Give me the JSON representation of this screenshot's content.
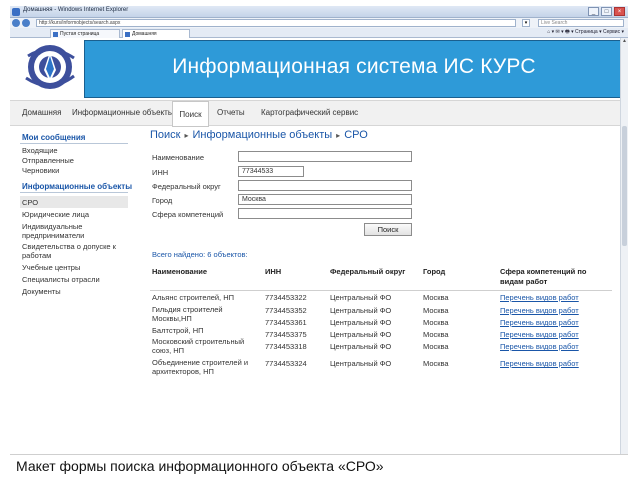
{
  "browser": {
    "window_title": "Домашняя - Windows Internet Explorer",
    "url": "http://kurs/informobjects/search.aspx",
    "search_placeholder": "Live Search",
    "tabs": [
      {
        "label": "Пустая страница"
      },
      {
        "label": "Домашняя"
      }
    ],
    "tools": "⌂ ▾  ✉ ▾  🖶 ▾  Страница ▾  Сервис ▾"
  },
  "banner": {
    "title": "Информационная  система ИС  КУРС"
  },
  "menu": {
    "items": [
      {
        "label": "Домашняя"
      },
      {
        "label": "Информационные объекты"
      },
      {
        "label": "Поиск"
      },
      {
        "label": "Отчеты"
      },
      {
        "label": "Картографический сервис"
      }
    ]
  },
  "sidebar": {
    "messages_title": "Мои сообщения",
    "messages_items": [
      {
        "label": "Входящие"
      },
      {
        "label": "Отправленные"
      },
      {
        "label": "Черновики"
      }
    ],
    "objects_title": "Информационные объекты",
    "objects_items": [
      {
        "label": "СРО"
      },
      {
        "label": "Юридические лица"
      },
      {
        "label": "Индивидуальные предприниматели"
      },
      {
        "label": "Свидетельства о допуске к работам"
      },
      {
        "label": "Учебные центры"
      },
      {
        "label": "Специалисты отрасли"
      },
      {
        "label": "Документы"
      }
    ]
  },
  "breadcrumb": [
    "Поиск",
    "Информационные объекты",
    "СРО"
  ],
  "form": {
    "fields": [
      {
        "label": "Наименование",
        "value": ""
      },
      {
        "label": "ИНН",
        "value": "77344533"
      },
      {
        "label": "Федеральный округ",
        "value": ""
      },
      {
        "label": "Город",
        "value": "Москва"
      },
      {
        "label": "Сфера компетенций",
        "value": ""
      }
    ],
    "search_button": "Поиск"
  },
  "results": {
    "found_text": "Всего найдено: 6 объектов:",
    "columns": [
      "Наименование",
      "ИНН",
      "Федеральный округ",
      "Город",
      "Сфера компетенций по видам работ"
    ],
    "rows": [
      {
        "name": "Альянс строителей, НП",
        "inn": "7734453322",
        "district": "Центральный ФО",
        "city": "Москва",
        "scope": "Перечень видов работ"
      },
      {
        "name": "Гильдия строителей Москвы,НП",
        "inn": "7734453352",
        "district": "Центральный ФО",
        "city": "Москва",
        "scope": "Перечень видов работ"
      },
      {
        "name": "",
        "inn": "7734453361",
        "district": "Центральный ФО",
        "city": "Москва",
        "scope": "Перечень видов работ"
      },
      {
        "name": "Балтстрой, НП",
        "inn": "7734453375",
        "district": "Центральный ФО",
        "city": "Москва",
        "scope": "Перечень видов работ"
      },
      {
        "name": "Московский строительный союз, НП",
        "inn": "7734453318",
        "district": "Центральный ФО",
        "city": "Москва",
        "scope": "Перечень видов работ"
      },
      {
        "name": "Объединение строителей и архитекторов, НП",
        "inn": "7734453324",
        "district": "Центральный ФО",
        "city": "Москва",
        "scope": "Перечень видов работ"
      }
    ]
  },
  "caption": "Макет формы поиска информационного объекта «СРО»",
  "colors": {
    "banner": "#2e9ad8",
    "link": "#1a56a8"
  }
}
